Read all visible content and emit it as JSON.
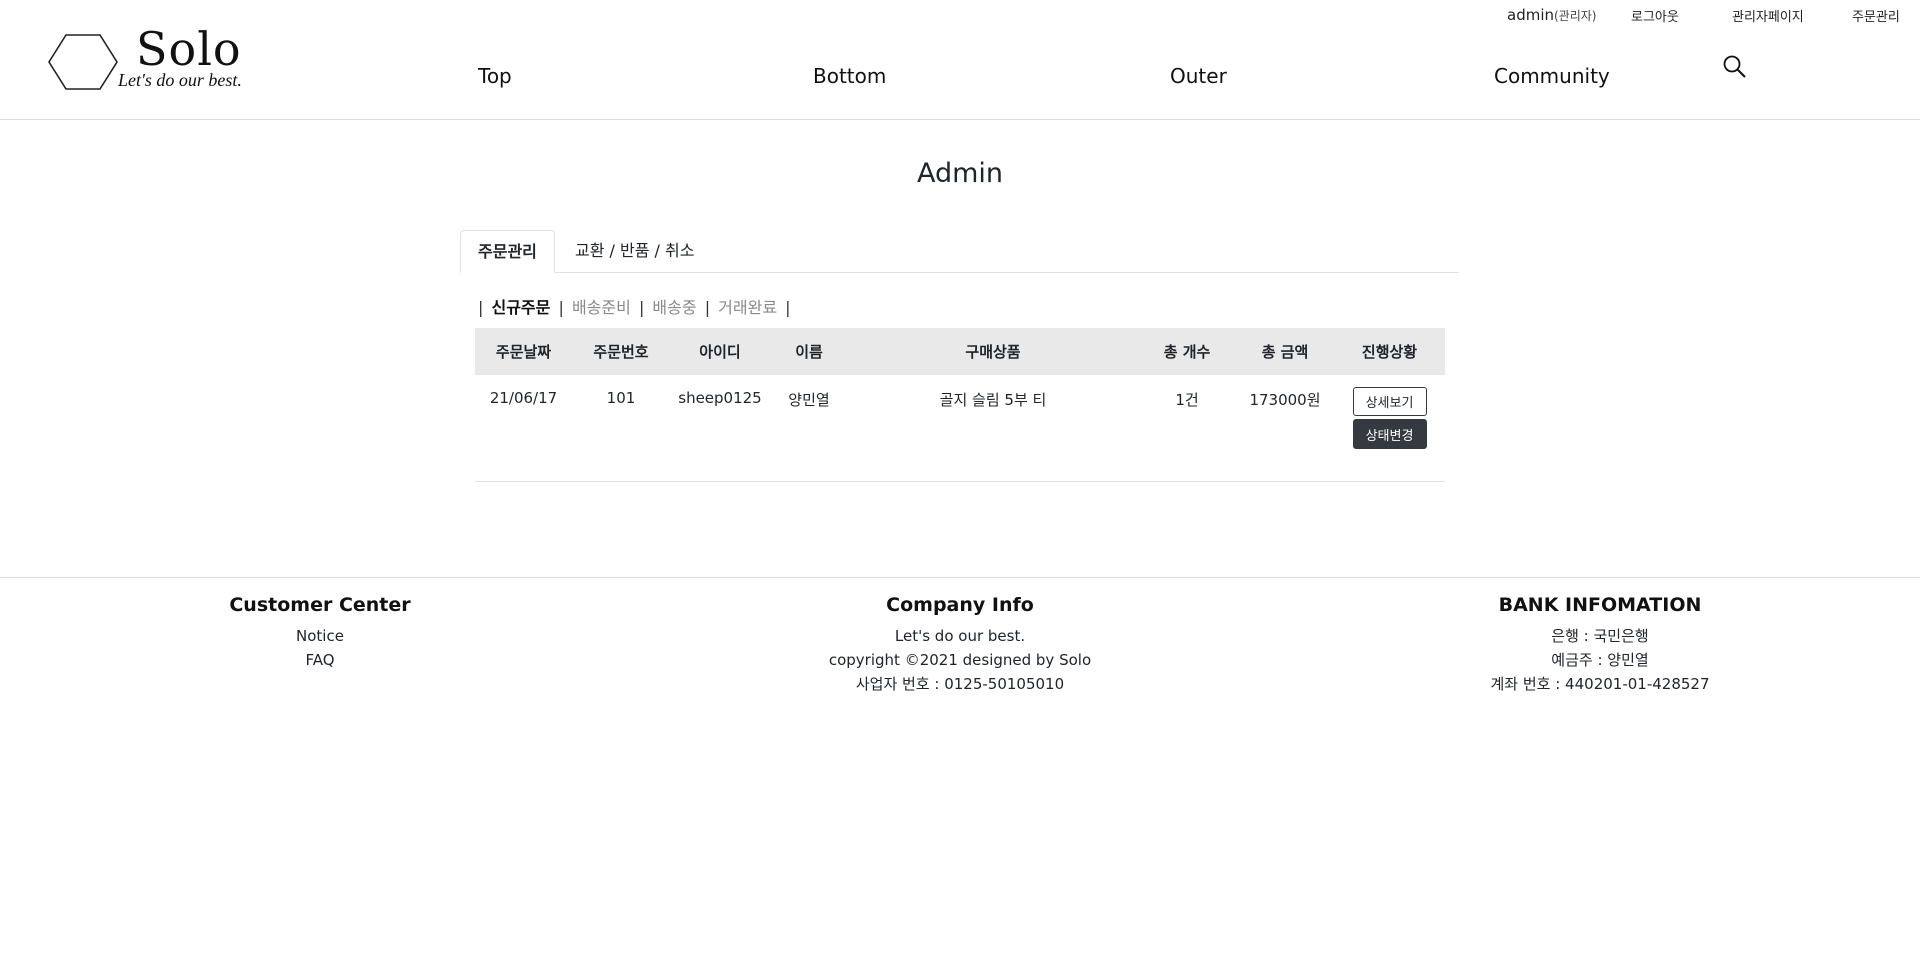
{
  "brand": {
    "name": "Solo",
    "slogan": "Let's do our best."
  },
  "util_nav": {
    "user": "admin",
    "role": "(관리자)",
    "logout": "로그아웃",
    "admin_page": "관리자페이지",
    "order_manage": "주문관리"
  },
  "main_nav": [
    "Top",
    "Bottom",
    "Outer",
    "Community"
  ],
  "page_title": "Admin",
  "tabs": [
    "주문관리",
    "교환 / 반품 / 취소"
  ],
  "status_filters": [
    "신규주문",
    "배송준비",
    "배송중",
    "거래완료"
  ],
  "table": {
    "headers": [
      "주문날짜",
      "주문번호",
      "아이디",
      "이름",
      "구매상품",
      "총 개수",
      "총 금액",
      "진행상황"
    ],
    "rows": [
      {
        "date": "21/06/17",
        "order_no": "101",
        "user_id": "sheep0125",
        "name": "양민열",
        "product": "골지 슬림 5부 티",
        "count": "1건",
        "total": "173000원",
        "detail_btn": "상세보기",
        "status_btn": "상태변경"
      }
    ]
  },
  "footer": {
    "customer_center": {
      "title": "Customer Center",
      "links": [
        "Notice",
        "FAQ"
      ]
    },
    "company_info": {
      "title": "Company Info",
      "lines": [
        "Let's do our best.",
        "copyright ©2021 designed by Solo",
        "사업자 번호 : 0125-50105010"
      ]
    },
    "bank_info": {
      "title": "BANK INFOMATION",
      "lines": [
        "은행 : 국민은행",
        "예금주 : 양민열",
        "계좌 번호 : 440201-01-428527"
      ]
    }
  },
  "icons": {
    "logo": "hexagon-logo-icon",
    "search": "search-icon"
  },
  "colors": {
    "dark_button": "#343a40",
    "table_header_bg": "#e9e9e9",
    "muted_link": "#8a8a8a"
  }
}
